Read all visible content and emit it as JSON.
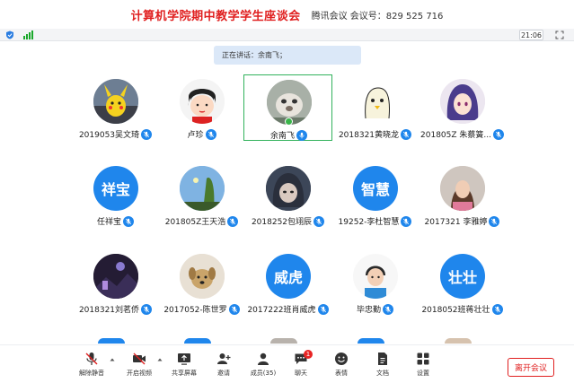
{
  "banner": {
    "title": "计算机学院期中教学学生座谈会",
    "meeting": "腾讯会议 会议号：829 525 716"
  },
  "titlebar": {
    "time": "21:06",
    "colors": {
      "signal": "#1ba82c",
      "shield": "#2a7de1"
    }
  },
  "speaking": "正在讲话：余南飞；",
  "participants": [
    {
      "name": "2019053吴文琦",
      "avatar": "pikachu-photo",
      "type": "image"
    },
    {
      "name": "卢珍",
      "avatar": "cartoon-girl-photo",
      "type": "image"
    },
    {
      "name": "余南飞",
      "avatar": "animal-photo",
      "type": "image",
      "active": true
    },
    {
      "name": "2018321黄晓龙",
      "avatar": "cartoon-chick-photo",
      "type": "image"
    },
    {
      "name": "201805Z 朱蔡簧...",
      "avatar": "anime-character-photo",
      "type": "image"
    },
    {
      "name": "任祥宝",
      "avatar_text": "祥宝",
      "type": "text"
    },
    {
      "name": "201805Z王天浩",
      "avatar": "landscape-photo",
      "type": "image"
    },
    {
      "name": "2018252包翊辰",
      "avatar": "anime-dark-photo",
      "type": "image"
    },
    {
      "name": "19252-李杜智慧",
      "avatar_text": "智慧",
      "type": "text"
    },
    {
      "name": "2017321 李雅婷",
      "avatar": "portrait-photo",
      "type": "image"
    },
    {
      "name": "2018321刘茗侨",
      "avatar": "night-scene-photo",
      "type": "image"
    },
    {
      "name": "2017052-陈世罗",
      "avatar": "dog-photo",
      "type": "image"
    },
    {
      "name": "2017222班肖威虎",
      "avatar_text": "威虎",
      "type": "text"
    },
    {
      "name": "毕忠勤",
      "avatar": "child-photo",
      "type": "image"
    },
    {
      "name": "2018052班蒋壮壮",
      "avatar_text": "壮壮",
      "type": "text"
    }
  ],
  "toolbar": {
    "mute": "解除静音",
    "video": "开启视频",
    "share": "共享屏幕",
    "invite": "邀请",
    "members": "成员(35)",
    "chat": "聊天",
    "chat_badge": "1",
    "reactions": "表情",
    "documents": "文档",
    "settings": "设置",
    "leave": "离开会议"
  },
  "colors": {
    "accent": "#1f86ec",
    "danger": "#e02020",
    "active_border": "#32b25c"
  }
}
